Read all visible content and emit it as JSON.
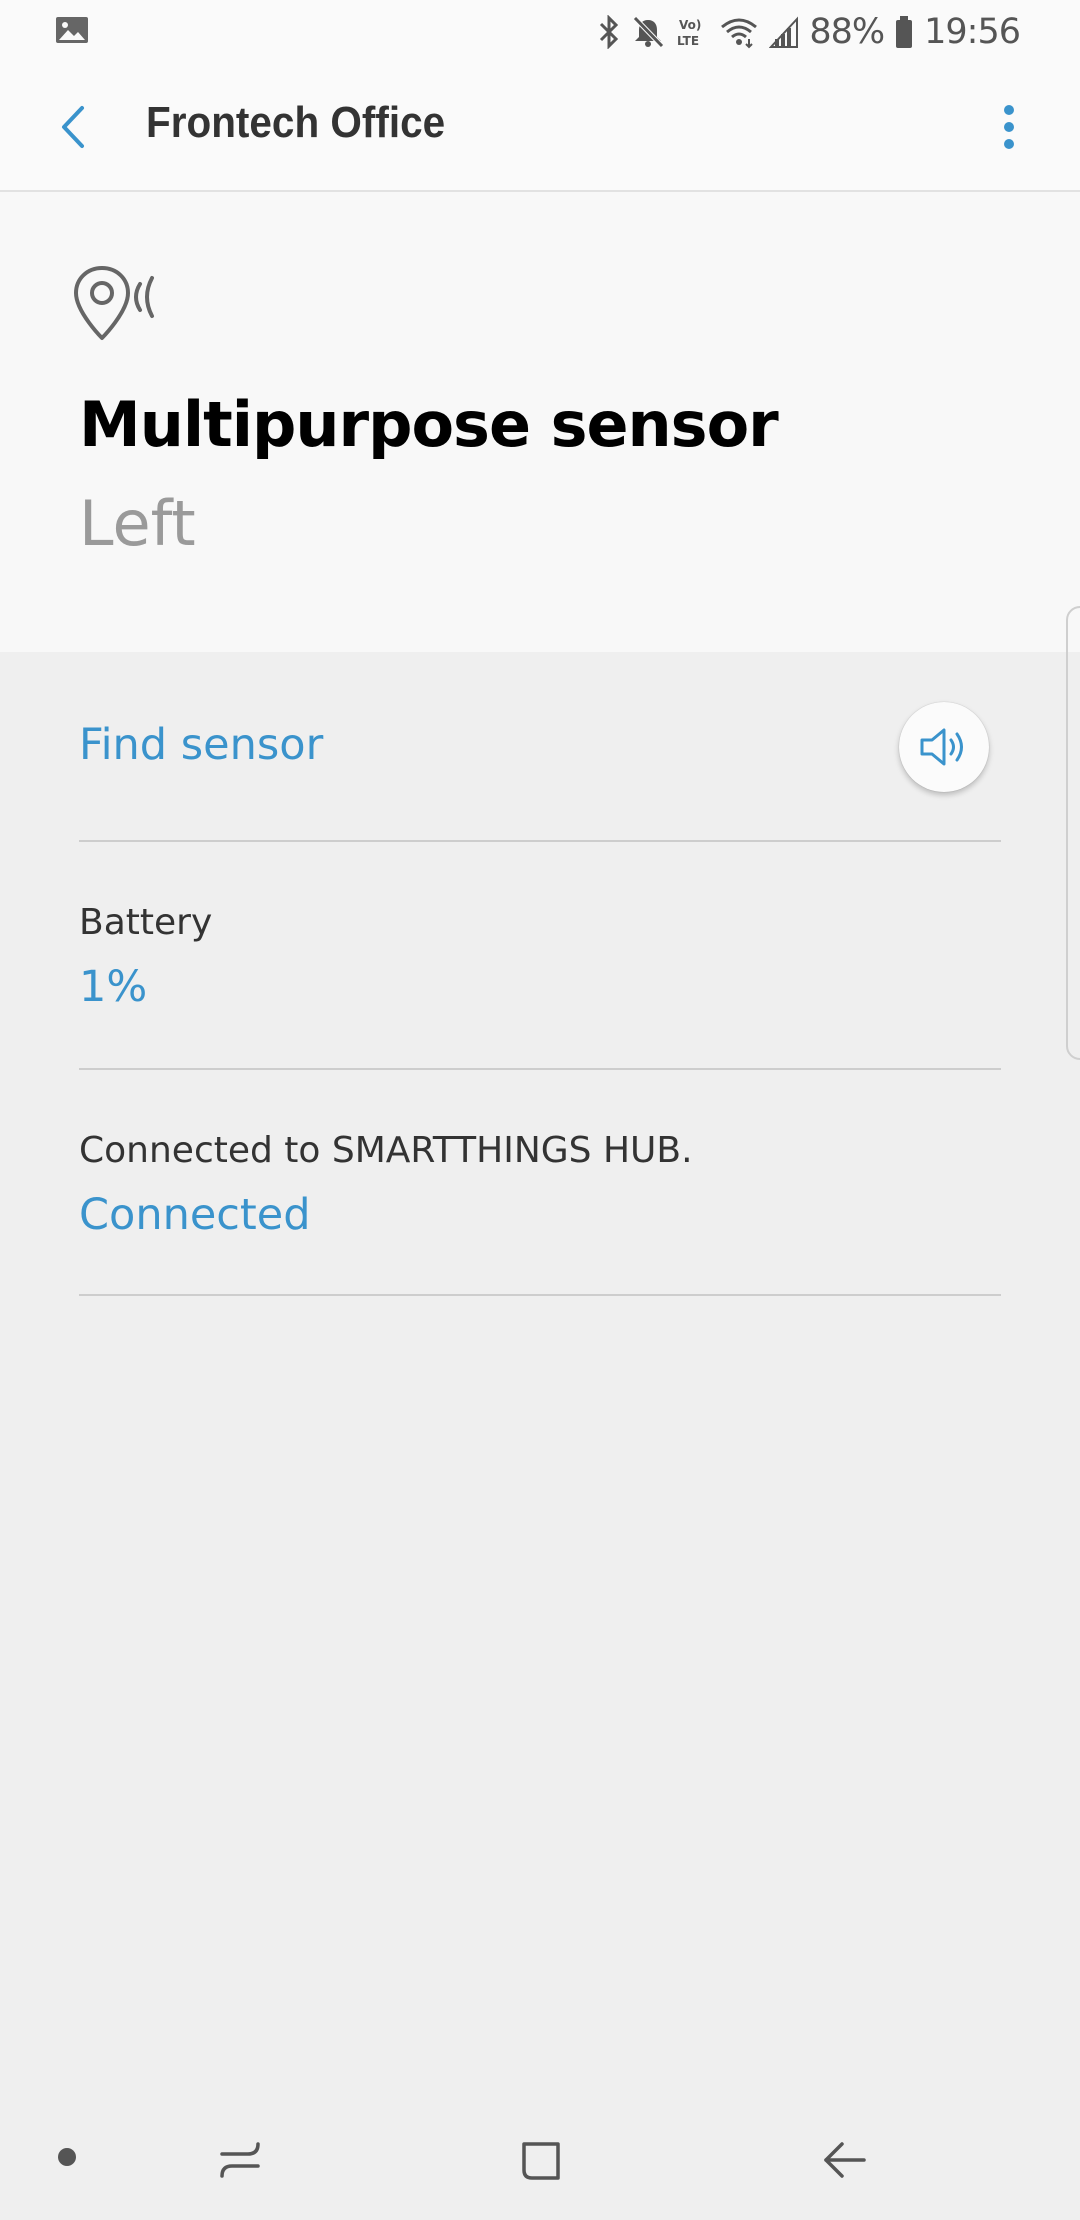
{
  "status_bar": {
    "battery_percent": "88%",
    "time": "19:56",
    "network_label": "Vo) LTE",
    "icons": [
      "gallery-icon",
      "bluetooth-icon",
      "mute-icon",
      "volte-icon",
      "wifi-icon",
      "signal-icon",
      "battery-icon"
    ]
  },
  "app_bar": {
    "title": "Frontech Office",
    "back_icon": "back-arrow-icon",
    "more_icon": "more-options-icon"
  },
  "device": {
    "icon": "multipurpose-sensor-icon",
    "name": "Multipurpose sensor",
    "room": "Left"
  },
  "find_sensor": {
    "label": "Find sensor",
    "icon": "speaker-icon"
  },
  "battery": {
    "label": "Battery",
    "value": "1%"
  },
  "connection": {
    "label": "Connected to SMARTTHINGS HUB.",
    "value": "Connected"
  },
  "nav_bar": {
    "icons": [
      "nav-dot-icon",
      "recents-icon",
      "home-icon",
      "back-icon"
    ]
  },
  "colors": {
    "accent": "#3a93cc",
    "background": "#efefef",
    "header_background": "#f8f8f8",
    "divider": "#cdcdcd"
  }
}
